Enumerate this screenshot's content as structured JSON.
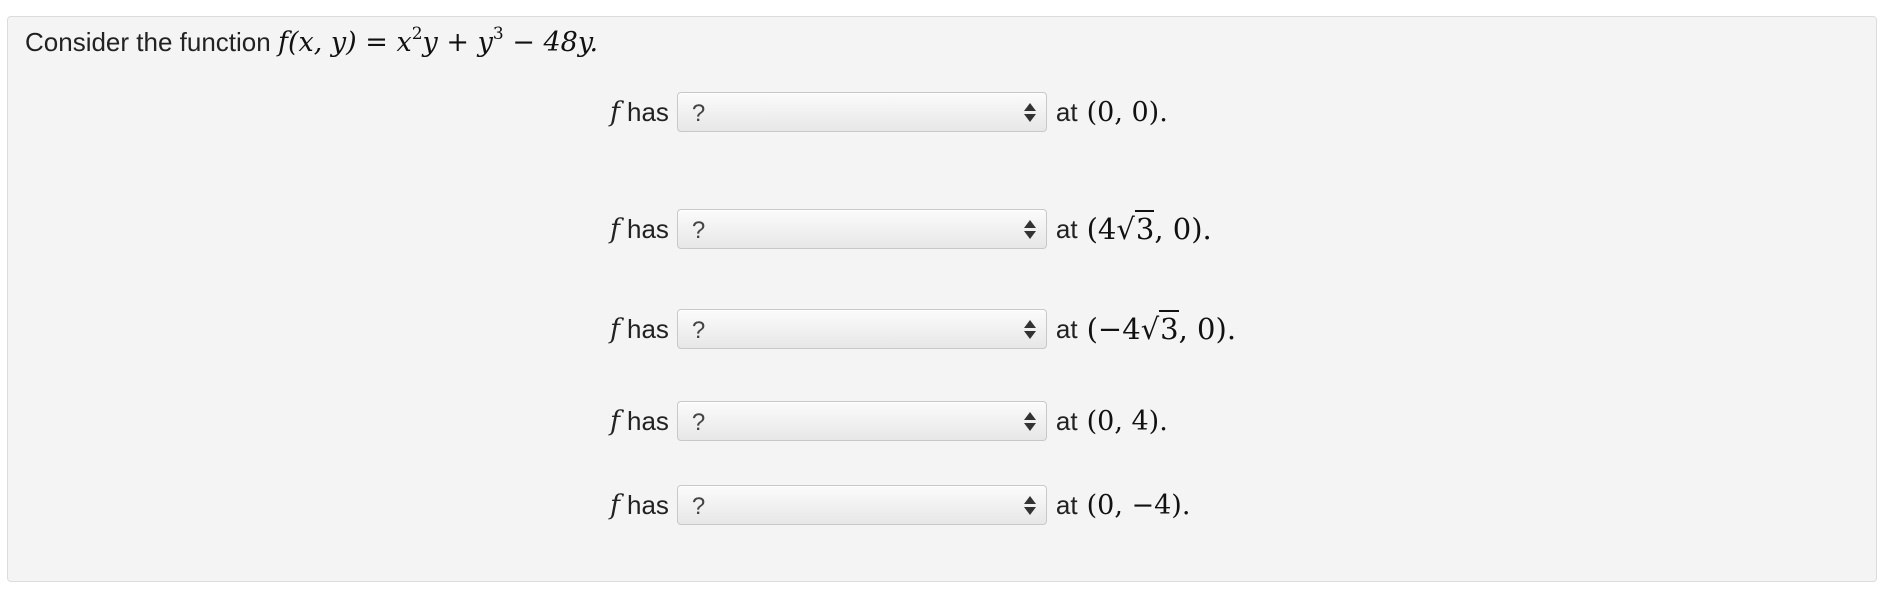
{
  "prompt": {
    "lead": "Consider the function",
    "function_lhs": "f(x, y) =",
    "t1_base": "x",
    "t1_exp": "2",
    "t1_tail": "y +",
    "t2_base": "y",
    "t2_exp": "3",
    "t2_tail": "− 48y."
  },
  "row_common": {
    "fvar": "f",
    "has_label": "has",
    "at_label": "at"
  },
  "rows": [
    {
      "selected": "?",
      "point": "(0, 0)."
    },
    {
      "selected": "?",
      "point_pre": "(4",
      "point_sqrt_sym": "√",
      "point_radicand": "3",
      "point_post": ", 0)."
    },
    {
      "selected": "?",
      "point_pre": "(−4",
      "point_sqrt_sym": "√",
      "point_radicand": "3",
      "point_post": ", 0)."
    },
    {
      "selected": "?",
      "point": "(0, 4)."
    },
    {
      "selected": "?",
      "point": "(0, −4)."
    }
  ],
  "icons": {
    "select_arrows": "up-down-arrows-icon"
  }
}
